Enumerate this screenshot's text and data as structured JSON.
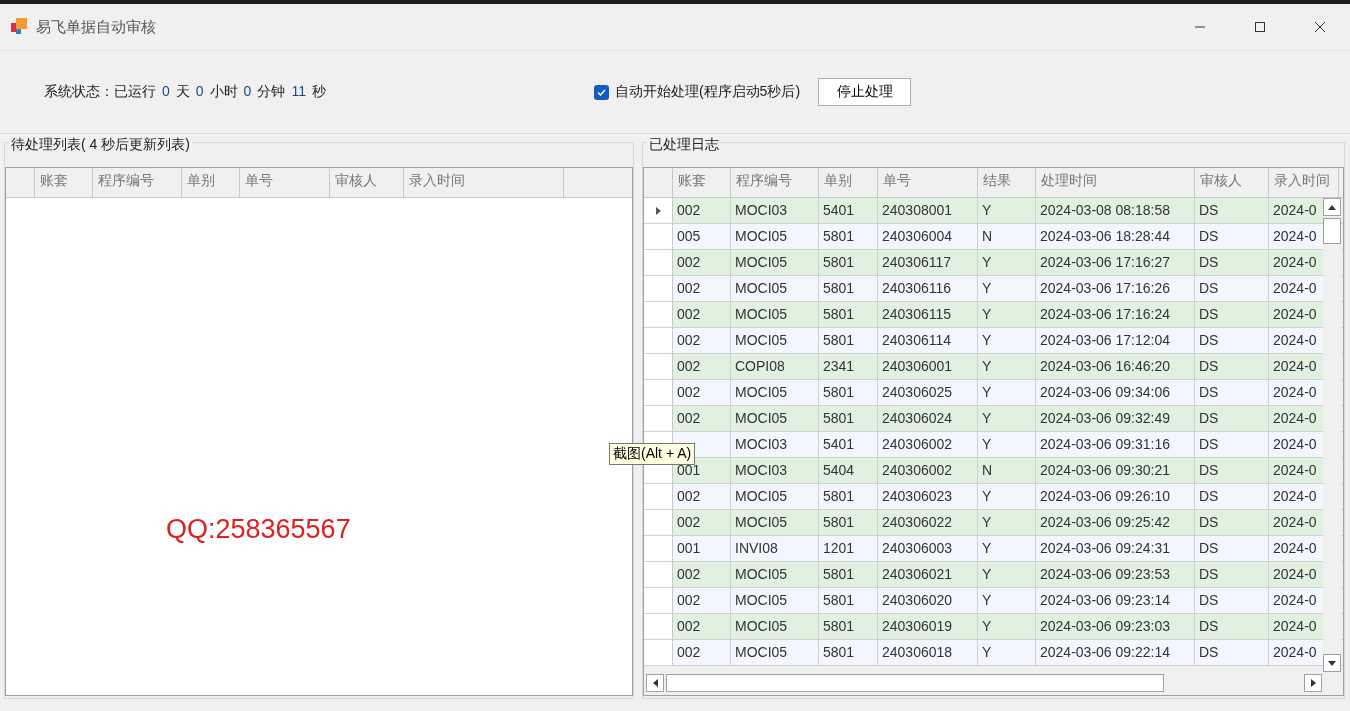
{
  "window": {
    "title": "易飞单据自动审核"
  },
  "status": [
    {
      "kind": "label",
      "text": "系统状态：已运行"
    },
    {
      "kind": "value",
      "text": "0"
    },
    {
      "kind": "label",
      "text": "天"
    },
    {
      "kind": "value",
      "text": "0"
    },
    {
      "kind": "label",
      "text": "小时"
    },
    {
      "kind": "value",
      "text": "0"
    },
    {
      "kind": "label",
      "text": "分钟"
    },
    {
      "kind": "value",
      "text": "11"
    },
    {
      "kind": "label",
      "text": "秒"
    }
  ],
  "auto_start": {
    "label": "自动开始处理(程序启动5秒后)",
    "checked": true
  },
  "stop_button": "停止处理",
  "pending": {
    "title": "待处理列表( 4 秒后更新列表)",
    "columns": [
      "账套",
      "程序编号",
      "单别",
      "单号",
      "审核人",
      "录入时间"
    ],
    "note": "QQ:258365567"
  },
  "log": {
    "title": "已处理日志",
    "columns": [
      "账套",
      "程序编号",
      "单别",
      "单号",
      "结果",
      "处理时间",
      "审核人",
      "录入时间"
    ],
    "rows": [
      {
        "selected": true,
        "cells": [
          "002",
          "MOCI03",
          "5401",
          "240308001",
          "Y",
          "2024-03-08 08:18:58",
          "DS",
          "2024-0"
        ]
      },
      {
        "selected": false,
        "cells": [
          "005",
          "MOCI05",
          "5801",
          "240306004",
          "N",
          "2024-03-06 18:28:44",
          "DS",
          "2024-0"
        ]
      },
      {
        "selected": false,
        "cells": [
          "002",
          "MOCI05",
          "5801",
          "240306117",
          "Y",
          "2024-03-06 17:16:27",
          "DS",
          "2024-0"
        ]
      },
      {
        "selected": false,
        "cells": [
          "002",
          "MOCI05",
          "5801",
          "240306116",
          "Y",
          "2024-03-06 17:16:26",
          "DS",
          "2024-0"
        ]
      },
      {
        "selected": false,
        "cells": [
          "002",
          "MOCI05",
          "5801",
          "240306115",
          "Y",
          "2024-03-06 17:16:24",
          "DS",
          "2024-0"
        ]
      },
      {
        "selected": false,
        "cells": [
          "002",
          "MOCI05",
          "5801",
          "240306114",
          "Y",
          "2024-03-06 17:12:04",
          "DS",
          "2024-0"
        ]
      },
      {
        "selected": false,
        "cells": [
          "002",
          "COPI08",
          "2341",
          "240306001",
          "Y",
          "2024-03-06 16:46:20",
          "DS",
          "2024-0"
        ]
      },
      {
        "selected": false,
        "cells": [
          "002",
          "MOCI05",
          "5801",
          "240306025",
          "Y",
          "2024-03-06 09:34:06",
          "DS",
          "2024-0"
        ]
      },
      {
        "selected": false,
        "cells": [
          "002",
          "MOCI05",
          "5801",
          "240306024",
          "Y",
          "2024-03-06 09:32:49",
          "DS",
          "2024-0"
        ]
      },
      {
        "selected": false,
        "cells": [
          null,
          "MOCI03",
          "5401",
          "240306002",
          "Y",
          "2024-03-06 09:31:16",
          "DS",
          "2024-0"
        ]
      },
      {
        "selected": false,
        "cells": [
          "001",
          "MOCI03",
          "5404",
          "240306002",
          "N",
          "2024-03-06 09:30:21",
          "DS",
          "2024-0"
        ]
      },
      {
        "selected": false,
        "cells": [
          "002",
          "MOCI05",
          "5801",
          "240306023",
          "Y",
          "2024-03-06 09:26:10",
          "DS",
          "2024-0"
        ]
      },
      {
        "selected": false,
        "cells": [
          "002",
          "MOCI05",
          "5801",
          "240306022",
          "Y",
          "2024-03-06 09:25:42",
          "DS",
          "2024-0"
        ]
      },
      {
        "selected": false,
        "cells": [
          "001",
          "INVI08",
          "1201",
          "240306003",
          "Y",
          "2024-03-06 09:24:31",
          "DS",
          "2024-0"
        ]
      },
      {
        "selected": false,
        "cells": [
          "002",
          "MOCI05",
          "5801",
          "240306021",
          "Y",
          "2024-03-06 09:23:53",
          "DS",
          "2024-0"
        ]
      },
      {
        "selected": false,
        "cells": [
          "002",
          "MOCI05",
          "5801",
          "240306020",
          "Y",
          "2024-03-06 09:23:14",
          "DS",
          "2024-0"
        ]
      },
      {
        "selected": false,
        "cells": [
          "002",
          "MOCI05",
          "5801",
          "240306019",
          "Y",
          "2024-03-06 09:23:03",
          "DS",
          "2024-0"
        ]
      },
      {
        "selected": false,
        "cells": [
          "002",
          "MOCI05",
          "5801",
          "240306018",
          "Y",
          "2024-03-06 09:22:14",
          "DS",
          "2024-0"
        ]
      }
    ]
  },
  "tooltip": "截图(Alt + A)"
}
